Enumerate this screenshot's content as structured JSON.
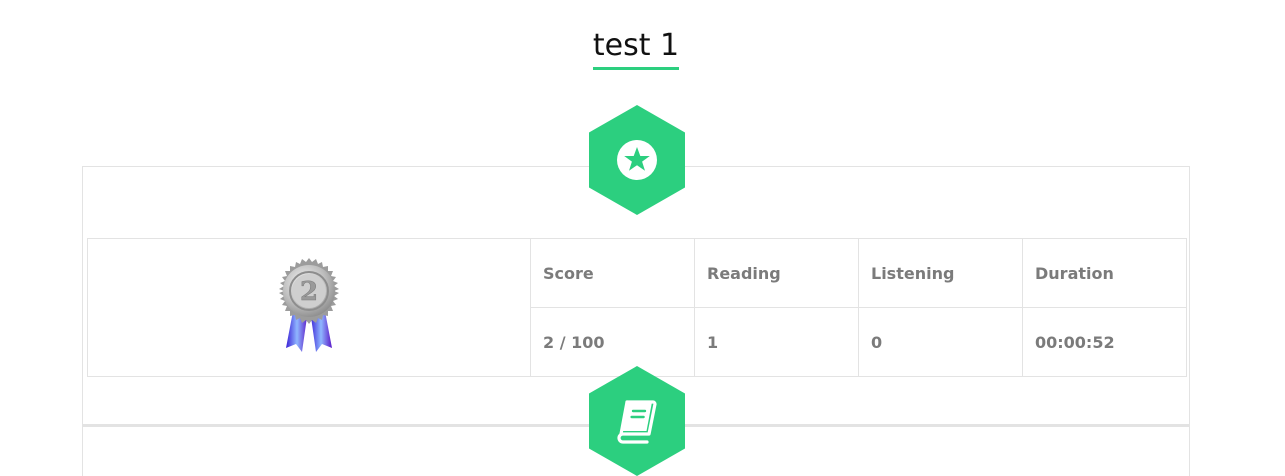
{
  "page": {
    "title": "test 1"
  },
  "icons": {
    "top_hex": "star-circle-icon",
    "bottom_hex": "book-icon",
    "medal": "silver-medal-2-icon"
  },
  "colors": {
    "accent": "#2ccf7f",
    "text_muted": "#7b7b7b",
    "border": "#e3e3e3",
    "title_text": "#111111"
  },
  "results": {
    "medal_rank": "2",
    "columns": [
      "Score",
      "Reading",
      "Listening",
      "Duration"
    ],
    "values": [
      "2 / 100",
      "1",
      "0",
      "00:00:52"
    ]
  }
}
